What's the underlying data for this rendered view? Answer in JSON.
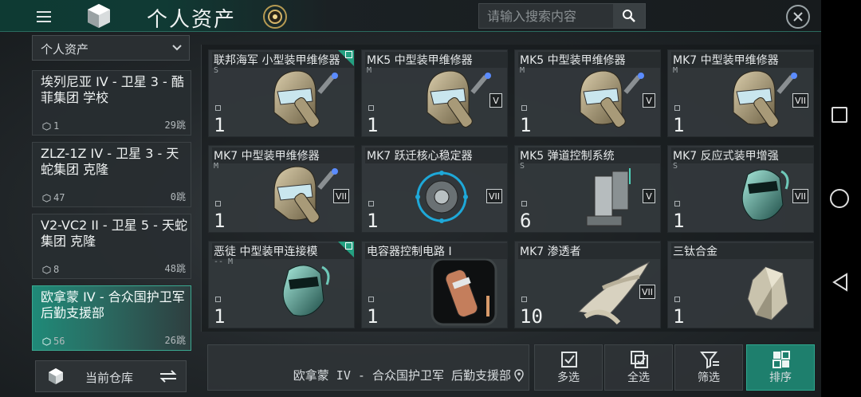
{
  "header": {
    "title": "个人资产",
    "search_placeholder": "请输入搜索内容"
  },
  "sidebar": {
    "location_filter": "个人资产",
    "locations": [
      {
        "name": "埃列尼亚 IV - 卫星 3 - 酷菲集团 学校",
        "count": "1",
        "jumps": "29跳",
        "active": false
      },
      {
        "name": "ZLZ-1Z IV - 卫星 3 - 天蛇集团 克隆",
        "count": "47",
        "jumps": "0跳",
        "active": false
      },
      {
        "name": "V2-VC2 II - 卫星 5 - 天蛇集团 克隆",
        "count": "8",
        "jumps": "48跳",
        "active": false
      },
      {
        "name": "欧拿蒙 IV - 合众国护卫军 后勤支援部",
        "count": "56",
        "jumps": "26跳",
        "active": true
      }
    ],
    "warehouse_label": "当前仓库"
  },
  "items": [
    {
      "name": "联邦海军 小型装甲维修器",
      "meta": "S",
      "qty": "1",
      "tech": "",
      "badge": true,
      "art": "repairer"
    },
    {
      "name": "MK5 中型装甲维修器",
      "meta": "M",
      "qty": "1",
      "tech": "V",
      "badge": false,
      "art": "repairer"
    },
    {
      "name": "MK5 中型装甲维修器",
      "meta": "M",
      "qty": "1",
      "tech": "V",
      "badge": false,
      "art": "repairer"
    },
    {
      "name": "MK7 中型装甲维修器",
      "meta": "M",
      "qty": "1",
      "tech": "VII",
      "badge": false,
      "art": "repairer"
    },
    {
      "name": "MK7 中型装甲维修器",
      "meta": "M",
      "qty": "1",
      "tech": "VII",
      "badge": false,
      "art": "repairer"
    },
    {
      "name": "MK7 跃迁核心稳定器",
      "meta": "",
      "qty": "1",
      "tech": "VII",
      "badge": false,
      "art": "stabilizer"
    },
    {
      "name": "MK5 弹道控制系统",
      "meta": "S",
      "qty": "6",
      "tech": "V",
      "badge": false,
      "art": "ballistic"
    },
    {
      "name": "MK7 反应式装甲增强",
      "meta": "S",
      "qty": "1",
      "tech": "VII",
      "badge": false,
      "art": "helmet"
    },
    {
      "name": "恶徒 中型装甲连接模",
      "meta": "-- M",
      "qty": "1",
      "tech": "",
      "badge": true,
      "art": "helmet"
    },
    {
      "name": "电容器控制电路 I",
      "meta": "",
      "qty": "1",
      "tech": "",
      "badge": false,
      "art": "capacitor"
    },
    {
      "name": "MK7 渗透者",
      "meta": "",
      "qty": "10",
      "tech": "VII",
      "badge": false,
      "art": "drone"
    },
    {
      "name": "三钛合金",
      "meta": "",
      "qty": "1",
      "tech": "",
      "badge": false,
      "art": "mineral"
    }
  ],
  "footer": {
    "station": "欧拿蒙 IV - 合众国护卫军 后勤支援部",
    "actions": [
      {
        "label": "多选",
        "icon": "checkbox-icon"
      },
      {
        "label": "全选",
        "icon": "select-all-icon"
      },
      {
        "label": "筛选",
        "icon": "filter-icon"
      },
      {
        "label": "排序",
        "icon": "sort-grid-icon"
      }
    ]
  },
  "colors": {
    "accent": "#1e7f6d",
    "badge": "#24a081"
  }
}
